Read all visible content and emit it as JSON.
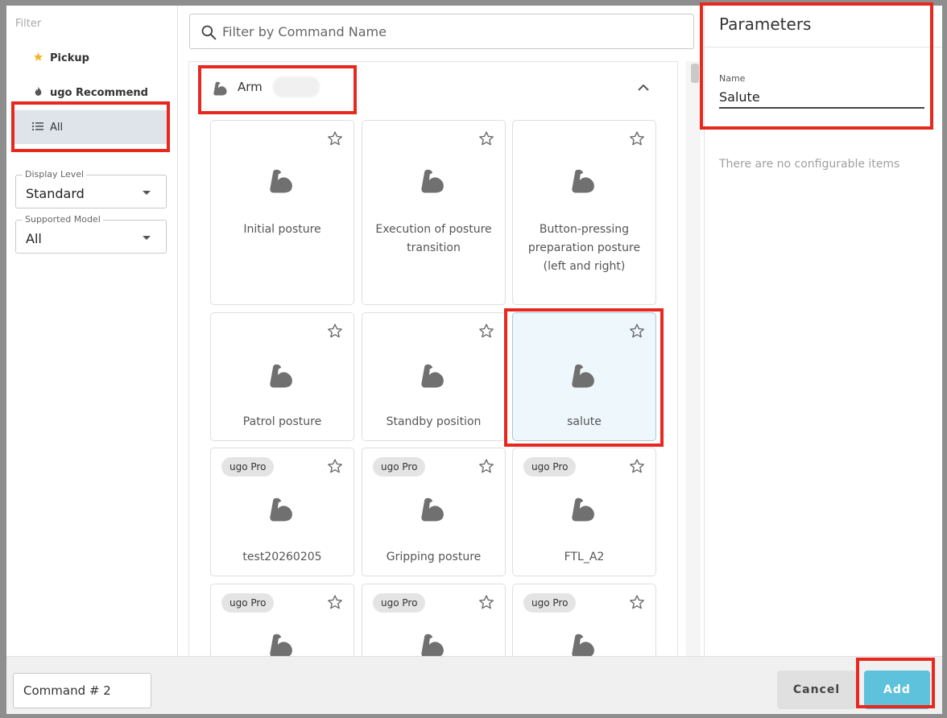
{
  "filter": {
    "title": "Filter",
    "items": [
      {
        "label": "Pickup",
        "icon": "star-icon",
        "icon_color": "#f2b824"
      },
      {
        "label": "ugo Recommend",
        "icon": "flame-icon"
      },
      {
        "label": "All",
        "icon": "list-icon",
        "selected": true
      }
    ],
    "display_level": {
      "label": "Display Level",
      "value": "Standard"
    },
    "supported_model": {
      "label": "Supported Model",
      "value": "All"
    }
  },
  "search": {
    "placeholder": "Filter by Command Name"
  },
  "section": {
    "title": "Arm",
    "icon": "arm-icon",
    "expanded": true
  },
  "cards": [
    {
      "name": "Initial posture",
      "badge": ""
    },
    {
      "name": "Execution of posture transition",
      "badge": ""
    },
    {
      "name": "Button-pressing preparation posture (left and right)",
      "badge": ""
    },
    {
      "name": "Patrol posture",
      "badge": ""
    },
    {
      "name": "Standby position",
      "badge": ""
    },
    {
      "name": "salute",
      "badge": "",
      "selected": true
    },
    {
      "name": "test20260205",
      "badge": "ugo Pro"
    },
    {
      "name": "Gripping posture",
      "badge": "ugo Pro"
    },
    {
      "name": "FTL_A2",
      "badge": "ugo Pro"
    },
    {
      "name": "",
      "badge": "ugo Pro"
    },
    {
      "name": "",
      "badge": "ugo Pro"
    },
    {
      "name": "",
      "badge": "ugo Pro"
    }
  ],
  "params": {
    "title": "Parameters",
    "name_label": "Name",
    "name_value": "Salute",
    "empty_text": "There are no configurable items"
  },
  "footer": {
    "command_name": "Command # 2",
    "cancel_label": "Cancel",
    "add_label": "Add"
  },
  "colors": {
    "accent": "#5ec2dc",
    "highlight": "#e8281e",
    "selected_filter": "#dfe3ea"
  }
}
